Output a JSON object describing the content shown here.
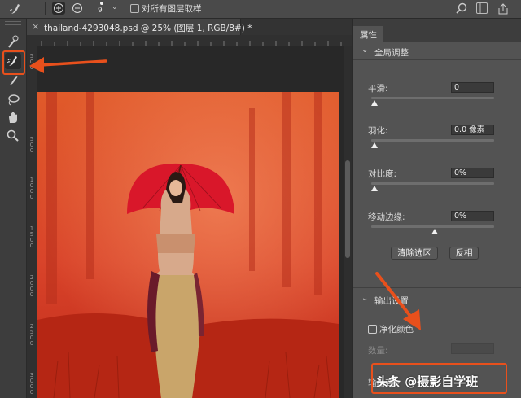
{
  "options_bar": {
    "brush_size": "9",
    "sample_all_layers_label": "对所有图层取样"
  },
  "document": {
    "tab_title": "thailand-4293048.psd @ 25% (图层 1, RGB/8#) *",
    "vertical_ruler_labels": [
      "5 0 0",
      "5 0 0",
      "1 0 0 0",
      "1 5 0 0",
      "2 0 0 0",
      "2 5 0 0",
      "3 0 0 0"
    ]
  },
  "properties_panel": {
    "tab_label": "属性",
    "global_section_label": "全局调整",
    "smooth": {
      "label": "平滑:",
      "value": "0"
    },
    "feather": {
      "label": "羽化:",
      "value": "0.0 像素"
    },
    "contrast": {
      "label": "对比度:",
      "value": "0%"
    },
    "shift_edge": {
      "label": "移动边缘:",
      "value": "0%"
    },
    "clear_selection_button": "清除选区",
    "invert_button": "反相",
    "output_section_label": "输出设置",
    "decontaminate_label": "净化颜色",
    "amount_label": "数量:",
    "output_to_label": "输出到:"
  },
  "watermark": {
    "text": "头条 @摄影自学班"
  },
  "colors": {
    "highlight": "#e8501c",
    "panel_bg": "#535353",
    "overlay_red": "#d4361b"
  }
}
